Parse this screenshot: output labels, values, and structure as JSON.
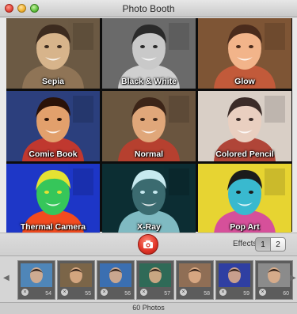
{
  "window": {
    "title": "Photo Booth"
  },
  "effects_grid": [
    {
      "label": "Sepia",
      "bg": "#6c5a44",
      "skin": "#d7b48b",
      "hair": "#3c2b1f",
      "shirt": "#8f7456"
    },
    {
      "label": "Black & White",
      "bg": "#6a6a6a",
      "skin": "#c9c9c9",
      "hair": "#2a2a2a",
      "shirt": "#d0d0d0"
    },
    {
      "label": "Glow",
      "bg": "#7e5535",
      "skin": "#f2b48a",
      "hair": "#4a2b1c",
      "shirt": "#c25a3a"
    },
    {
      "label": "Comic Book",
      "bg": "#2c3f7d",
      "skin": "#e2a06c",
      "hair": "#2a1208",
      "shirt": "#c0382f"
    },
    {
      "label": "Normal",
      "bg": "#6a563f",
      "skin": "#e0a77a",
      "hair": "#3c2518",
      "shirt": "#b6402f"
    },
    {
      "label": "Colored Pencil",
      "bg": "#d9cfc6",
      "skin": "#e9cfc0",
      "hair": "#3b2c28",
      "shirt": "#b04538"
    },
    {
      "label": "Thermal Camera",
      "bg": "#1e37c7",
      "skin": "#36c65a",
      "hair": "#e5e233",
      "shirt": "#f24b1f"
    },
    {
      "label": "X-Ray",
      "bg": "#0c2e33",
      "skin": "#3b6b70",
      "hair": "#c7e9ef",
      "shirt": "#7fbac2"
    },
    {
      "label": "Pop Art",
      "bg": "#e7d432",
      "skin": "#39b9cf",
      "hair": "#1b1b1b",
      "shirt": "#d6509a"
    }
  ],
  "controls": {
    "effects_label": "Effects",
    "page_1": "1",
    "page_2": "2",
    "shutter_color": "#e3372a"
  },
  "filmstrip": {
    "items": [
      {
        "num": "54",
        "tint": "#4f86b8"
      },
      {
        "num": "55",
        "tint": "#7b6548"
      },
      {
        "num": "56",
        "tint": "#3b6fb1"
      },
      {
        "num": "57",
        "tint": "#2f6a57"
      },
      {
        "num": "58",
        "tint": "#8f6e55"
      },
      {
        "num": "59",
        "tint": "#2f3fa2"
      },
      {
        "num": "60",
        "tint": "#8b8b8b"
      }
    ]
  },
  "status": {
    "text": "60 Photos"
  }
}
